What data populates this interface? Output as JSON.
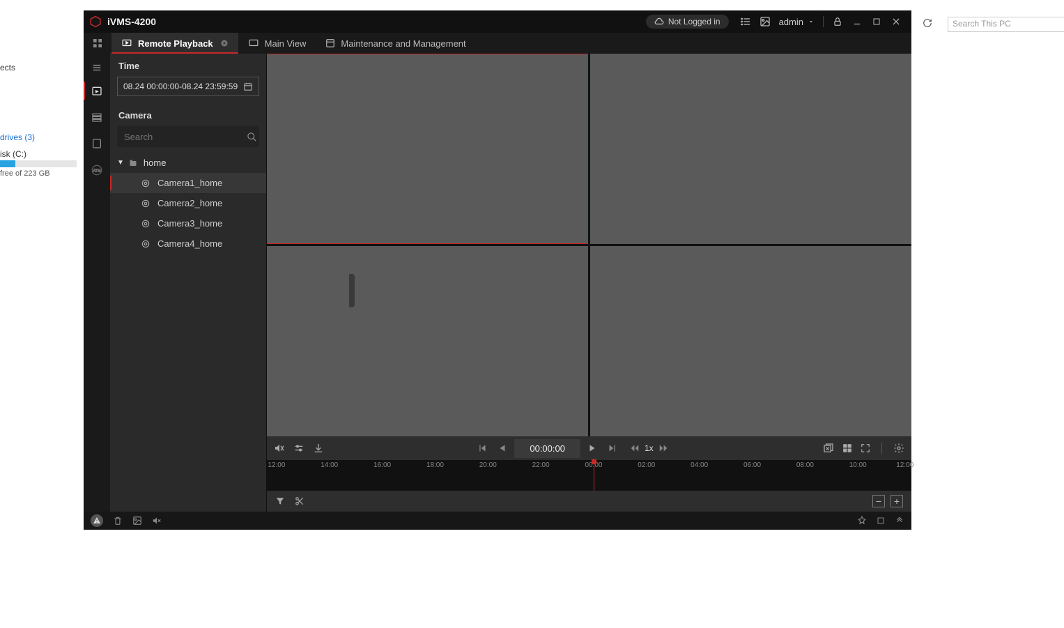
{
  "bg": {
    "ects": "ects",
    "drives": "drives (3)",
    "disk": "isk (C:)",
    "free": "free of 223 GB",
    "search_placeholder": "Search This PC"
  },
  "titlebar": {
    "app": "iVMS-4200",
    "login_status": "Not Logged in",
    "user": "admin"
  },
  "tabs": {
    "remote_playback": "Remote Playback",
    "main_view": "Main View",
    "maintenance": "Maintenance and Management"
  },
  "panel": {
    "time_label": "Time",
    "time_range": "08.24 00:00:00-08.24 23:59:59",
    "camera_label": "Camera",
    "search_placeholder": "Search",
    "group": "home",
    "cams": [
      "Camera1_home",
      "Camera2_home",
      "Camera3_home",
      "Camera4_home"
    ]
  },
  "playback": {
    "timecode": "00:00:00",
    "speed": "1x"
  },
  "timeline": {
    "ticks": [
      "12:00",
      "14:00",
      "16:00",
      "18:00",
      "20:00",
      "22:00",
      "00:00",
      "02:00",
      "04:00",
      "06:00",
      "08:00",
      "10:00",
      "12:00"
    ]
  }
}
